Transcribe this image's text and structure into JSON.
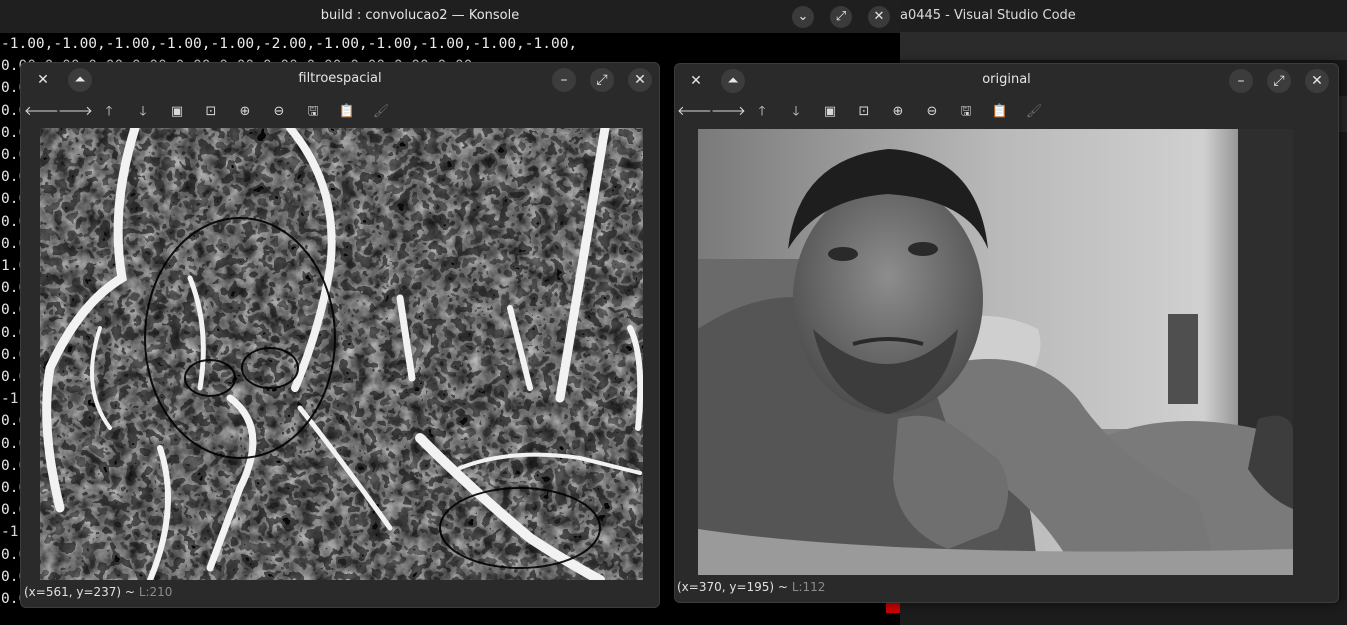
{
  "konsole": {
    "title": "build : convolucao2 — Konsole",
    "buttons": {
      "minimize": "⌄",
      "maximize": "⤢",
      "close": "✕"
    },
    "lines": [
      "-1.00,-1.00,-1.00,-1.00,-1.00,-2.00,-1.00,-1.00,-1.00,-1.00,-1.00,",
      "0.00,0.00,0.00,0.00,0.00,0.00,0.00,0.00,0.00,0.00,0.00,",
      "0.0",
      "0.0",
      "0.0",
      "0.0",
      "0.0",
      "0.0",
      "0.0",
      "0.0",
      "1.0",
      "0.0",
      "0.0",
      "0.0",
      "0.0",
      "0.0",
      "-1",
      "0.0",
      "0.0",
      "0.0",
      "0.0",
      "0.0",
      "-1",
      "0.0",
      "0.0",
      "0.00,0.00,0.00,0.00,0.00,0.00,0.00,0.00,0.00,0.00,0.00,"
    ]
  },
  "vscode": {
    "title": "a0445 - Visual Studio Code"
  },
  "filtro": {
    "title": "filtroespacial",
    "status_coords": "(x=561, y=237) ~",
    "status_lum": "L:210"
  },
  "original": {
    "title": "original",
    "status_coords": "(x=370, y=195) ~",
    "status_lum": "L:112"
  },
  "window_controls": {
    "close": "✕",
    "shade": "⏶",
    "minimize": "–",
    "maximize": "⤢",
    "dismiss": "✕"
  },
  "toolbar": [
    {
      "name": "pan-left-icon",
      "glyph": "🡐"
    },
    {
      "name": "pan-right-icon",
      "glyph": "🡒"
    },
    {
      "name": "pan-up-icon",
      "glyph": "🡑"
    },
    {
      "name": "pan-down-icon",
      "glyph": "🡓"
    },
    {
      "name": "zoom-fit-icon",
      "glyph": "▣"
    },
    {
      "name": "zoom-original-icon",
      "glyph": "⊡"
    },
    {
      "name": "zoom-in-icon",
      "glyph": "⊕"
    },
    {
      "name": "zoom-out-icon",
      "glyph": "⊖"
    },
    {
      "name": "save-icon",
      "glyph": "🖫"
    },
    {
      "name": "copy-icon",
      "glyph": "📋"
    },
    {
      "name": "properties-icon",
      "glyph": "🖌"
    }
  ]
}
